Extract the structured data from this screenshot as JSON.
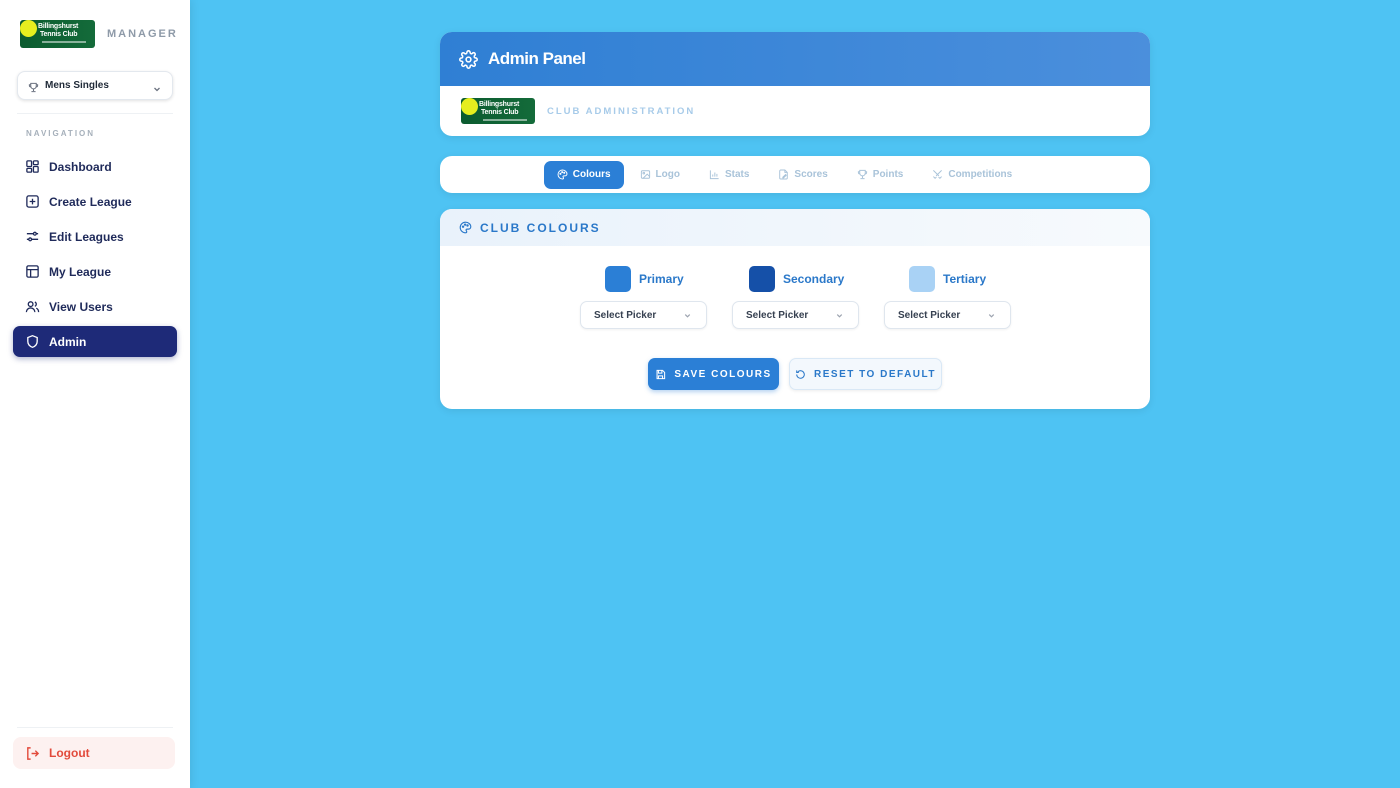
{
  "app": {
    "role_label": "MANAGER",
    "logo_text_line1": "Billingshurst",
    "logo_text_line2": "Tennis Club"
  },
  "league_selector": {
    "selected": "Mens Singles"
  },
  "navigation": {
    "title": "NAVIGATION",
    "items": [
      {
        "label": "Dashboard",
        "icon": "dashboard-icon"
      },
      {
        "label": "Create League",
        "icon": "plus-square-icon"
      },
      {
        "label": "Edit Leagues",
        "icon": "sliders-icon"
      },
      {
        "label": "My League",
        "icon": "table-icon"
      },
      {
        "label": "View Users",
        "icon": "users-icon"
      },
      {
        "label": "Admin",
        "icon": "shield-icon",
        "active": true
      }
    ],
    "logout_label": "Logout"
  },
  "header": {
    "title": "Admin Panel",
    "subtitle": "CLUB ADMINISTRATION"
  },
  "tabs": [
    {
      "label": "Colours",
      "icon": "palette-icon",
      "active": true
    },
    {
      "label": "Logo",
      "icon": "image-icon"
    },
    {
      "label": "Stats",
      "icon": "bar-chart-icon"
    },
    {
      "label": "Scores",
      "icon": "score-sheet-icon"
    },
    {
      "label": "Points",
      "icon": "trophy-icon"
    },
    {
      "label": "Competitions",
      "icon": "crossed-swords-icon"
    }
  ],
  "club_colours": {
    "title": "CLUB COLOURS",
    "swatches": [
      {
        "label": "Primary",
        "color": "#2b7fd6",
        "picker": "Select Picker"
      },
      {
        "label": "Secondary",
        "color": "#1550a8",
        "picker": "Select Picker"
      },
      {
        "label": "Tertiary",
        "color": "#a9d2f5",
        "picker": "Select Picker"
      }
    ],
    "save_label": "SAVE COLOURS",
    "reset_label": "RESET TO DEFAULT"
  },
  "colors": {
    "background": "#4ec3f3",
    "accent": "#2b7fd6",
    "nav_active": "#1e2a78",
    "logout": "#e24a3b"
  }
}
